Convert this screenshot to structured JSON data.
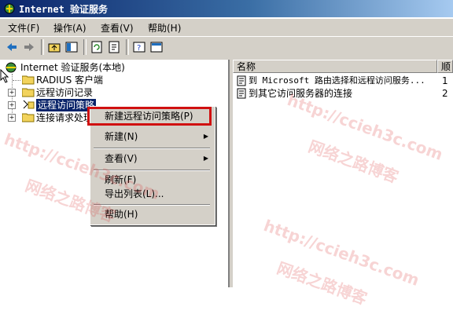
{
  "window": {
    "title": "Internet 验证服务"
  },
  "menubar": [
    {
      "label": "文件(F)"
    },
    {
      "label": "操作(A)"
    },
    {
      "label": "查看(V)"
    },
    {
      "label": "帮助(H)"
    }
  ],
  "tree": {
    "root": "Internet 验证服务(本地)",
    "items": [
      {
        "label": "RADIUS 客户端"
      },
      {
        "label": "远程访问记录"
      },
      {
        "label": "远程访问策略"
      },
      {
        "label": "连接请求处理"
      }
    ]
  },
  "list": {
    "headers": [
      "名称",
      "顺序"
    ],
    "rows": [
      {
        "name": "到 Microsoft 路由选择和远程访问服务...",
        "order": "1"
      },
      {
        "name": "到其它访问服务器的连接",
        "order": "2"
      }
    ]
  },
  "context_menu": {
    "items": [
      {
        "label": "新建远程访问策略(P)"
      },
      {
        "label": "新建(N)"
      },
      {
        "label": "查看(V)"
      },
      {
        "label": "刷新(F)"
      },
      {
        "label": "导出列表(L)..."
      },
      {
        "label": "帮助(H)"
      }
    ]
  },
  "watermark": {
    "line1": "http://ccieh3c.com",
    "line2": "网络之路博客"
  }
}
